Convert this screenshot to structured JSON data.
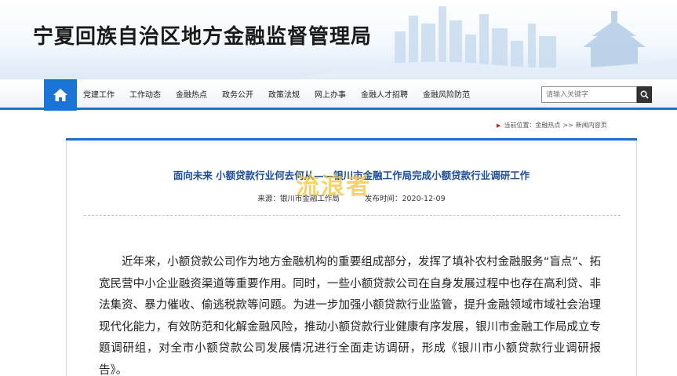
{
  "header": {
    "site_title": "宁夏回族自治区地方金融监督管理局"
  },
  "nav": {
    "home_icon": "home-icon",
    "items": [
      {
        "label": "党建工作"
      },
      {
        "label": "工作动态"
      },
      {
        "label": "金融热点"
      },
      {
        "label": "政务公开"
      },
      {
        "label": "政策法规"
      },
      {
        "label": "网上办事"
      },
      {
        "label": "金融人才招聘"
      },
      {
        "label": "金融风险防范"
      }
    ],
    "search": {
      "placeholder": "请输入关键字",
      "icon": "search-icon"
    }
  },
  "breadcrumb": {
    "prefix": "当前位置：",
    "items": [
      "金融热点",
      "新闻内容页"
    ],
    "separator": ">>"
  },
  "article": {
    "title": "面向未来 小额贷款行业何去何从——银川市金融工作局完成小额贷款行业调研工作",
    "source_label": "来源：",
    "source_value": "银川市金融工作局",
    "time_label": "发布时间：",
    "time_value": "2020-12-09",
    "body": "近年来，小额贷款公司作为地方金融机构的重要组成部分，发挥了填补农村金融服务“盲点”、拓宽民营中小企业融资渠道等重要作用。同时，一些小额贷款公司在自身发展过程中也存在高利贷、非法集资、暴力催收、偷逃税款等问题。为进一步加强小额贷款行业监管，提升金融领域市域社会治理现代化能力，有效防范和化解金融风险，推动小额贷款行业健康有序发展，银川市金融工作局成立专题调研组，对全市小额贷款公司发展情况进行全面走访调研，形成《银川市小额贷款行业调研报告》。"
  },
  "watermark": {
    "text": "流浪者"
  },
  "colors": {
    "nav_accent": "#1c6fcf",
    "title_blue": "#1a4d9c"
  }
}
